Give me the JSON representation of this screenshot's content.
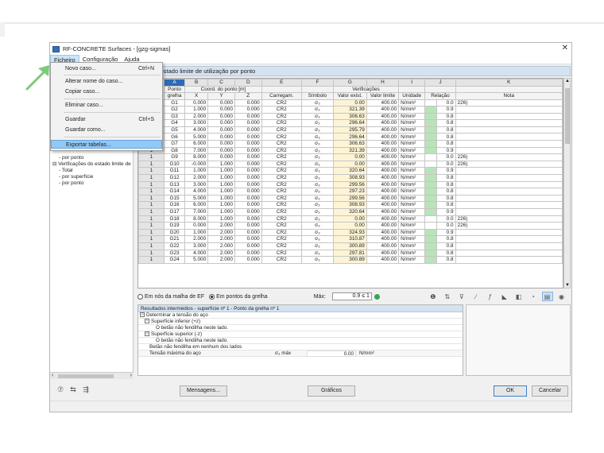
{
  "window": {
    "title": "RF-CONCRETE Surfaces - [gzg-sigmas]",
    "close_glyph": "✕"
  },
  "menubar": [
    "Ficheiro",
    "Configuração",
    "Ajuda"
  ],
  "file_menu": {
    "items": [
      {
        "label": "Novo caso...",
        "shortcut": "Ctrl+N"
      },
      {
        "label": "Alterar nome do caso...",
        "shortcut": ""
      },
      {
        "label": "Copiar caso...",
        "shortcut": ""
      },
      {
        "label": "Eliminar caso...",
        "shortcut": ""
      },
      {
        "label": "Guardar",
        "shortcut": "Ctrl+S"
      },
      {
        "label": "Guardar como...",
        "shortcut": ""
      },
      {
        "label": "Exportar tabelas...",
        "shortcut": ""
      }
    ],
    "highlighted": "Exportar tabelas..."
  },
  "tree": {
    "items": [
      {
        "label": "por ponto",
        "level": 2
      },
      {
        "label": "Verificações do estado limite de",
        "level": 1
      },
      {
        "label": "Total",
        "level": 2
      },
      {
        "label": "por superfície",
        "level": 2
      },
      {
        "label": "por ponto",
        "level": 2
      }
    ]
  },
  "panel_title": "ões do estado limite de utilização por ponto",
  "grid": {
    "col_letters": [
      "A",
      "B",
      "C",
      "D",
      "E",
      "F",
      "G",
      "H",
      "I",
      "J",
      "K"
    ],
    "group_header": {
      "ponto": "Ponto",
      "coord": "Coord. do ponto [m]",
      "verif": "Verificações"
    },
    "headers": [
      "grelha",
      "X",
      "Y",
      "Z",
      "Carregam.",
      "Símbolo",
      "Valor exist.",
      "Valor limite",
      "Unidade",
      "Relação",
      "Nota"
    ],
    "rows": [
      [
        "1",
        "G1",
        "0.000",
        "0.000",
        "0.000",
        "CR2",
        "σ₃",
        "0.00",
        "400.00",
        "N/mm²",
        "0.0",
        "226)"
      ],
      [
        "1",
        "G2",
        "1.000",
        "0.000",
        "0.000",
        "CR2",
        "σ₃",
        "321.39",
        "400.00",
        "N/mm²",
        "0.9",
        ""
      ],
      [
        "1",
        "G3",
        "2.000",
        "0.000",
        "0.000",
        "CR2",
        "σ₃",
        "306.63",
        "400.00",
        "N/mm²",
        "0.8",
        ""
      ],
      [
        "1",
        "G4",
        "3.000",
        "0.000",
        "0.000",
        "CR2",
        "σ₃",
        "296.64",
        "400.00",
        "N/mm²",
        "0.8",
        ""
      ],
      [
        "1",
        "G5",
        "4.000",
        "0.000",
        "0.000",
        "CR2",
        "σ₃",
        "295.79",
        "400.00",
        "N/mm²",
        "0.8",
        ""
      ],
      [
        "1",
        "G6",
        "5.000",
        "0.000",
        "0.000",
        "CR2",
        "σ₃",
        "296.64",
        "400.00",
        "N/mm²",
        "0.8",
        ""
      ],
      [
        "1",
        "G7",
        "6.000",
        "0.000",
        "0.000",
        "CR2",
        "σ₃",
        "306.63",
        "400.00",
        "N/mm²",
        "0.8",
        ""
      ],
      [
        "1",
        "G8",
        "7.000",
        "0.000",
        "0.000",
        "CR2",
        "σ₃",
        "321.39",
        "400.00",
        "N/mm²",
        "0.9",
        ""
      ],
      [
        "1",
        "G9",
        "8.000",
        "0.000",
        "0.000",
        "CR2",
        "σ₃",
        "0.00",
        "400.00",
        "N/mm²",
        "0.0",
        "226)"
      ],
      [
        "1",
        "G10",
        "-0.000",
        "1.000",
        "0.000",
        "CR2",
        "σ₃",
        "0.00",
        "400.00",
        "N/mm²",
        "0.0",
        "226)"
      ],
      [
        "1",
        "G11",
        "1.000",
        "1.000",
        "0.000",
        "CR2",
        "σ₃",
        "320.64",
        "400.00",
        "N/mm²",
        "0.9",
        ""
      ],
      [
        "1",
        "G12",
        "2.000",
        "1.000",
        "0.000",
        "CR2",
        "σ₃",
        "308.93",
        "400.00",
        "N/mm²",
        "0.8",
        ""
      ],
      [
        "1",
        "G13",
        "3.000",
        "1.000",
        "0.000",
        "CR2",
        "σ₃",
        "299.56",
        "400.00",
        "N/mm²",
        "0.8",
        ""
      ],
      [
        "1",
        "G14",
        "4.000",
        "1.000",
        "0.000",
        "CR2",
        "σ₃",
        "297.23",
        "400.00",
        "N/mm²",
        "0.8",
        ""
      ],
      [
        "1",
        "G15",
        "5.000",
        "1.000",
        "0.000",
        "CR2",
        "σ₃",
        "299.56",
        "400.00",
        "N/mm²",
        "0.8",
        ""
      ],
      [
        "1",
        "G16",
        "6.000",
        "1.000",
        "0.000",
        "CR2",
        "σ₃",
        "308.93",
        "400.00",
        "N/mm²",
        "0.8",
        ""
      ],
      [
        "1",
        "G17",
        "7.000",
        "1.000",
        "0.000",
        "CR2",
        "σ₃",
        "320.64",
        "400.00",
        "N/mm²",
        "0.9",
        ""
      ],
      [
        "1",
        "G18",
        "8.000",
        "1.000",
        "0.000",
        "CR2",
        "σ₃",
        "0.00",
        "400.00",
        "N/mm²",
        "0.0",
        "226)"
      ],
      [
        "1",
        "G19",
        "0.000",
        "2.000",
        "0.000",
        "CR2",
        "σ₃",
        "0.00",
        "400.00",
        "N/mm²",
        "0.0",
        "226)"
      ],
      [
        "1",
        "G20",
        "1.000",
        "2.000",
        "0.000",
        "CR2",
        "σ₃",
        "324.93",
        "400.00",
        "N/mm²",
        "0.9",
        ""
      ],
      [
        "1",
        "G21",
        "2.000",
        "2.000",
        "0.000",
        "CR2",
        "σ₃",
        "310.87",
        "400.00",
        "N/mm²",
        "0.8",
        ""
      ],
      [
        "1",
        "G22",
        "3.000",
        "2.000",
        "0.000",
        "CR2",
        "σ₃",
        "300.89",
        "400.00",
        "N/mm²",
        "0.8",
        ""
      ],
      [
        "1",
        "G23",
        "4.000",
        "2.000",
        "0.000",
        "CR2",
        "σ₃",
        "297.81",
        "400.00",
        "N/mm²",
        "0.8",
        ""
      ],
      [
        "1",
        "G24",
        "5.000",
        "2.000",
        "0.000",
        "CR2",
        "σ₃",
        "300.89",
        "400.00",
        "N/mm²",
        "0.8",
        ""
      ]
    ]
  },
  "options": {
    "radio_fe": "Em nós da malha de EF",
    "radio_grid": "Em pontos da grelha",
    "max_label": "Máx:",
    "max_value": "0.9 ≤ 1"
  },
  "results": {
    "title": "Resultados intermédios  -  superfície nº 1 - Ponto da grelha nº 1",
    "lines": [
      "Determinar a tensão do aço",
      "Superfície inferior (+z)",
      "O betão não fendilha neste lado.",
      "Superfície superior (-z)",
      "O betão não fendilha neste lado.",
      "Betão não fendilha em nenhum dos lados"
    ],
    "last_row": {
      "label": "Tensão máxima do aço",
      "symbol": "σ₃ máx",
      "value": "0.00",
      "unit": "N/mm²"
    }
  },
  "buttons": {
    "mensagens": "Mensagens...",
    "graficos": "Gráficos",
    "ok": "OK",
    "cancelar": "Cancelar"
  },
  "colors": {
    "accent": "#2e6ab5",
    "highlight": "#90c8f6",
    "ok_green": "#b9e4b9",
    "arrow": "#7cc97a"
  }
}
